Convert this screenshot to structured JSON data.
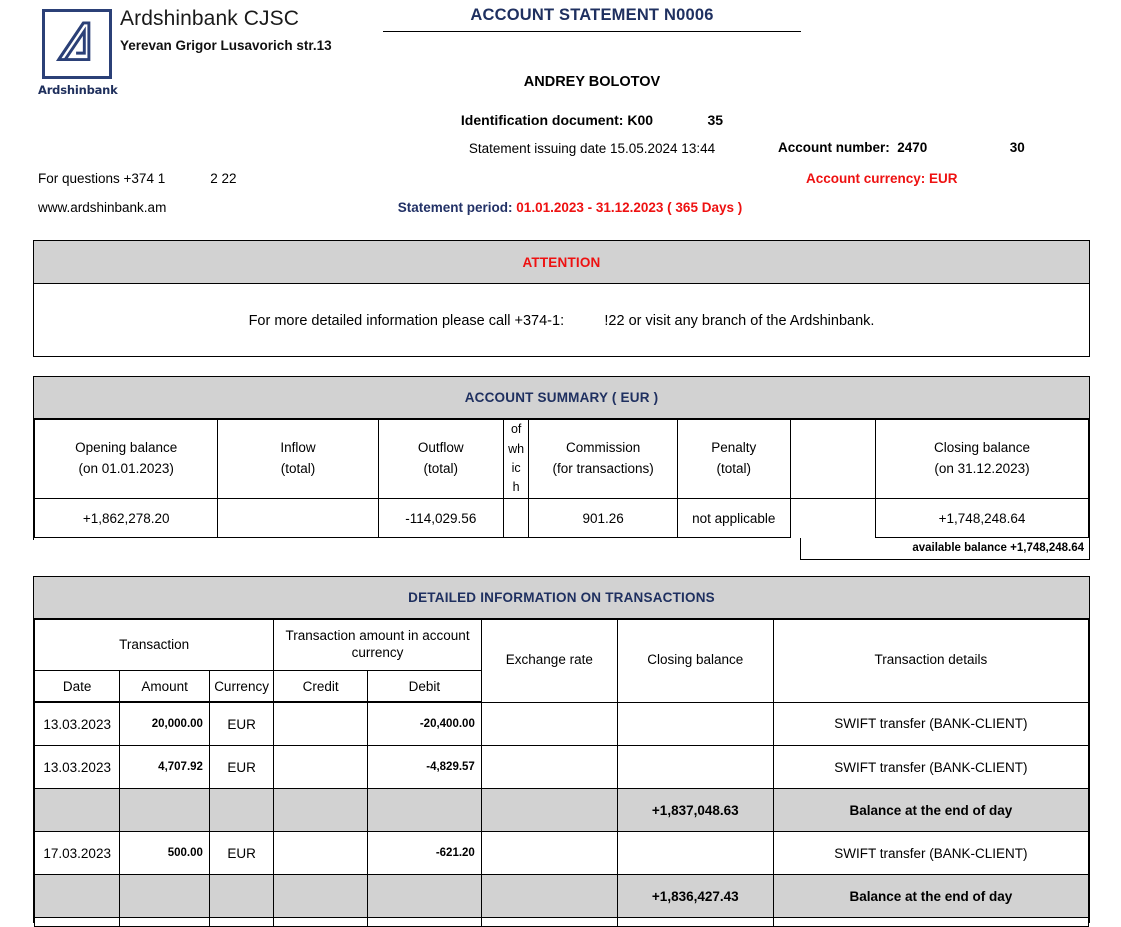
{
  "header": {
    "bank_name": "Ardshinbank CJSC",
    "bank_address": "Yerevan Grigor Lusavorich str.13",
    "logo_wordmark": "Ardshinbank",
    "document_title": "ACCOUNT STATEMENT N0006",
    "customer_name": "ANDREY BOLOTOV",
    "identification_document": "Identification document: K00              35",
    "issuing_date": "Statement issuing date 15.05.2024 13:44",
    "account_number": "Account number:  2470                      30",
    "account_currency": "Account currency: EUR",
    "for_questions": "For questions +374 1            2 22",
    "website": "www.ardshinbank.am",
    "statement_period_label": "Statement period: ",
    "statement_period_value": "01.01.2023 - 31.12.2023 ( 365 Days )"
  },
  "attention": {
    "title": "ATTENTION",
    "body": "For more detailed information please call +374-1:          !22 or visit any branch of the Ardshinbank."
  },
  "summary": {
    "title": "ACCOUNT SUMMARY ( EUR )",
    "headers": [
      "Opening balance\n(on 01.01.2023)",
      "Inflow\n(total)",
      "Outflow\n(total)",
      "of\nwhic\nh",
      "Commission\n(for transactions)",
      "Penalty\n(total)",
      "",
      "Closing balance\n(on 31.12.2023)"
    ],
    "values": [
      "+1,862,278.20",
      "",
      "-114,029.56",
      "",
      "901.26",
      "not applicable",
      "",
      "+1,748,248.64"
    ],
    "available_balance": "available balance +1,748,248.64"
  },
  "transactions": {
    "title": "DETAILED INFORMATION ON TRANSACTIONS",
    "group_headers": {
      "transaction": "Transaction",
      "amount_in_account_currency": "Transaction amount in account currency",
      "exchange_rate": "Exchange rate",
      "closing_balance": "Closing balance",
      "details": "Transaction details"
    },
    "sub_headers": {
      "date": "Date",
      "amount": "Amount",
      "currency": "Currency",
      "credit": "Credit",
      "debit": "Debit"
    },
    "rows": [
      {
        "shaded": false,
        "date": "13.03.2023",
        "amount": "20,000.00",
        "currency": "EUR",
        "credit": "",
        "debit": "-20,400.00",
        "rate": "",
        "balance": "",
        "details": "SWIFT transfer (BANK-CLIENT)"
      },
      {
        "shaded": false,
        "date": "13.03.2023",
        "amount": "4,707.92",
        "currency": "EUR",
        "credit": "",
        "debit": "-4,829.57",
        "rate": "",
        "balance": "",
        "details": "SWIFT transfer (BANK-CLIENT)"
      },
      {
        "shaded": true,
        "date": "",
        "amount": "",
        "currency": "",
        "credit": "",
        "debit": "",
        "rate": "",
        "balance": "+1,837,048.63",
        "details": "Balance at the end of day"
      },
      {
        "shaded": false,
        "date": "17.03.2023",
        "amount": "500.00",
        "currency": "EUR",
        "credit": "",
        "debit": "-621.20",
        "rate": "",
        "balance": "",
        "details": "SWIFT transfer (BANK-CLIENT)"
      },
      {
        "shaded": true,
        "date": "",
        "amount": "",
        "currency": "",
        "credit": "",
        "debit": "",
        "rate": "",
        "balance": "+1,836,427.43",
        "details": "Balance at the end of day"
      }
    ]
  },
  "colors": {
    "brand_navy": "#1f3060",
    "alert_red": "#ee1111",
    "band_gray": "#d2d2d2"
  }
}
